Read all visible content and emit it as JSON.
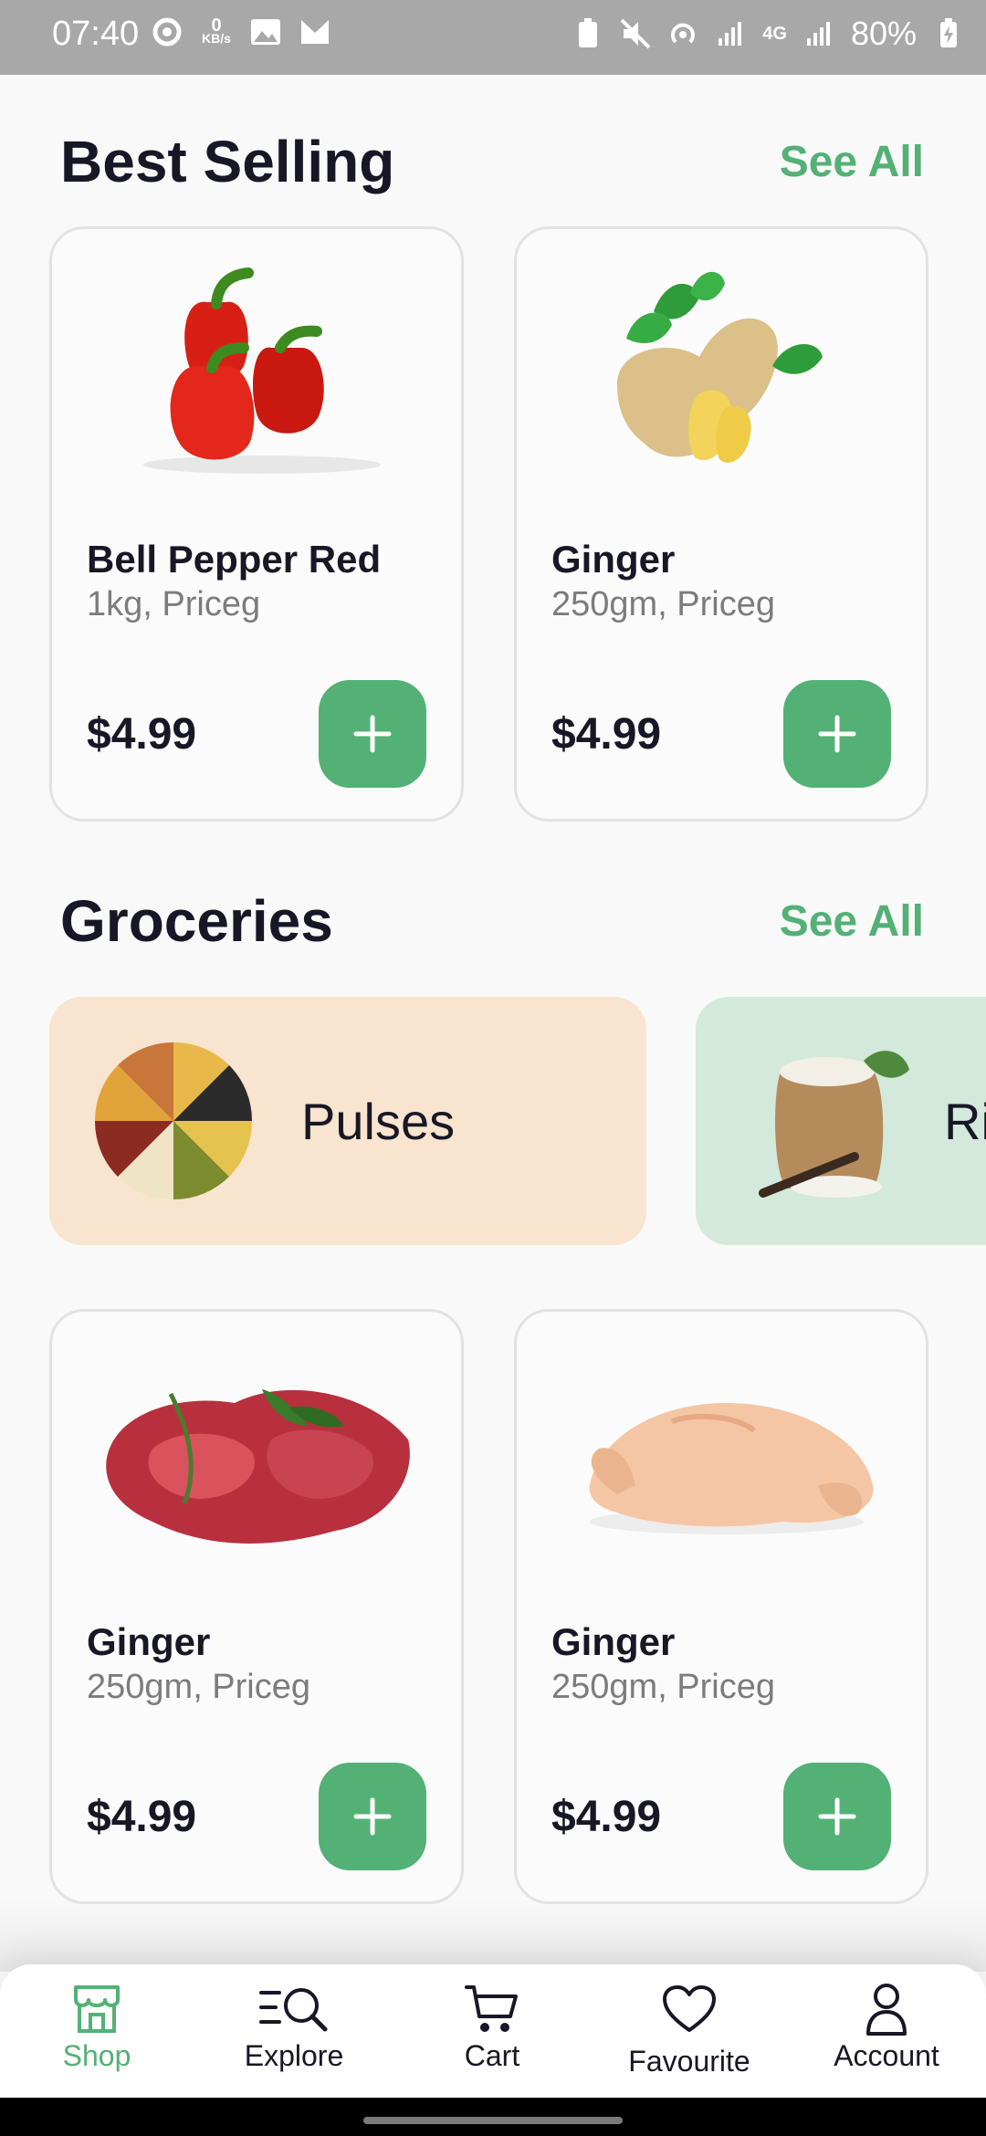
{
  "status_bar": {
    "time": "07:40",
    "kbs_value": "0",
    "kbs_unit": "KB/s",
    "network": "4G",
    "battery": "80%"
  },
  "best_selling": {
    "title": "Best Selling",
    "see_all": "See All",
    "products": [
      {
        "name": "Bell Pepper Red",
        "subtitle": "1kg, Priceg",
        "price": "$4.99",
        "image": "bell-pepper-image"
      },
      {
        "name": "Ginger",
        "subtitle": "250gm, Priceg",
        "price": "$4.99",
        "image": "ginger-image"
      }
    ]
  },
  "groceries": {
    "title": "Groceries",
    "see_all": "See All",
    "categories": [
      {
        "label": "Pulses",
        "color": "#f8e4cf",
        "image": "pulses-image"
      },
      {
        "label": "Ri",
        "color": "#d3e9dc",
        "image": "rice-image"
      }
    ],
    "products": [
      {
        "name": "Ginger",
        "subtitle": "250gm, Priceg",
        "price": "$4.99",
        "image": "meat-image"
      },
      {
        "name": "Ginger",
        "subtitle": "250gm, Priceg",
        "price": "$4.99",
        "image": "chicken-image"
      }
    ]
  },
  "bottom_nav": {
    "items": [
      {
        "label": "Shop",
        "icon": "store-icon",
        "active": true
      },
      {
        "label": "Explore",
        "icon": "explore-icon",
        "active": false
      },
      {
        "label": "Cart",
        "icon": "cart-icon",
        "active": false
      },
      {
        "label": "Favourite",
        "icon": "heart-icon",
        "active": false
      },
      {
        "label": "Account",
        "icon": "user-icon",
        "active": false
      }
    ]
  },
  "colors": {
    "accent": "#53b175",
    "text": "#181725",
    "muted": "#7c7c7c"
  }
}
